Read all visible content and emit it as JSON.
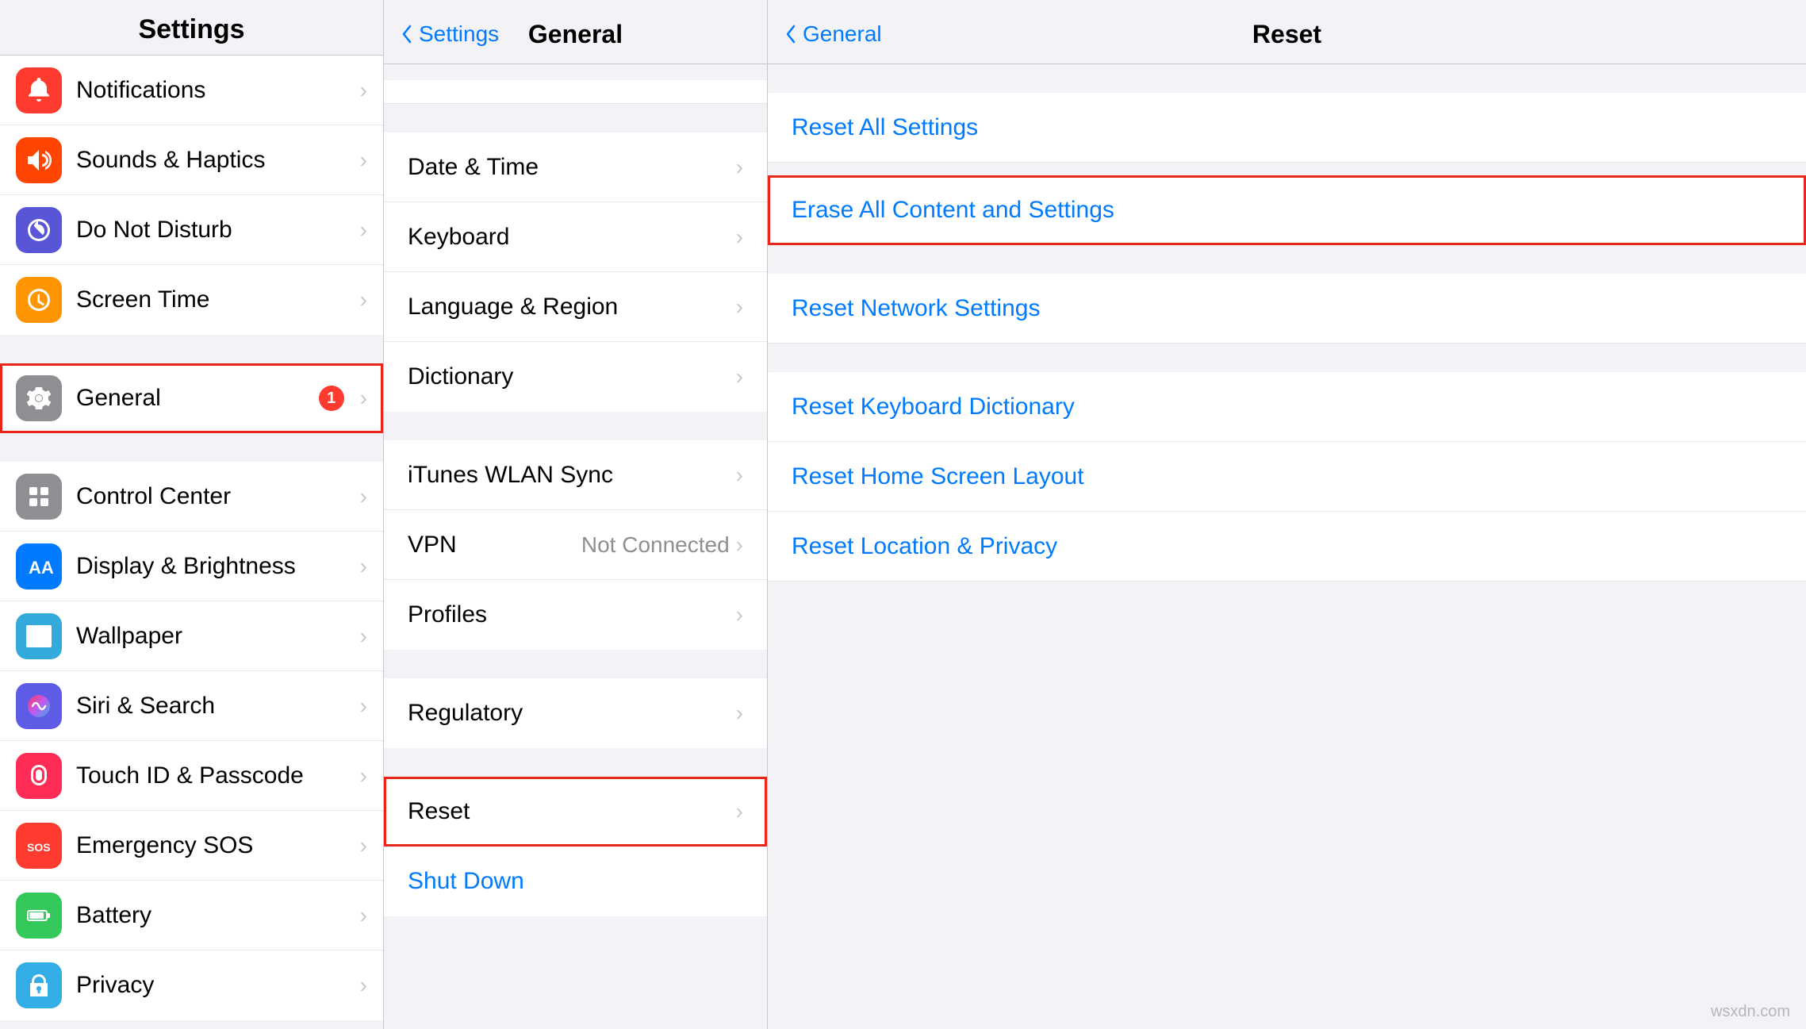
{
  "settings_column": {
    "title": "Settings",
    "items": [
      {
        "id": "notifications",
        "label": "Notifications",
        "icon_color": "icon-red",
        "icon_type": "bell",
        "badge": null
      },
      {
        "id": "sounds",
        "label": "Sounds & Haptics",
        "icon_color": "icon-orange-red",
        "icon_type": "sound",
        "badge": null
      },
      {
        "id": "dnd",
        "label": "Do Not Disturb",
        "icon_color": "icon-purple",
        "icon_type": "moon",
        "badge": null
      },
      {
        "id": "screentime",
        "label": "Screen Time",
        "icon_color": "icon-orange",
        "icon_type": "hourglass",
        "badge": null
      },
      {
        "id": "general",
        "label": "General",
        "icon_color": "icon-gray",
        "icon_type": "gear",
        "badge": "1",
        "selected": true
      },
      {
        "id": "controlcenter",
        "label": "Control Center",
        "icon_color": "icon-gray",
        "icon_type": "sliders",
        "badge": null
      },
      {
        "id": "display",
        "label": "Display & Brightness",
        "icon_color": "icon-blue",
        "icon_type": "aa",
        "badge": null
      },
      {
        "id": "wallpaper",
        "label": "Wallpaper",
        "icon_color": "icon-teal",
        "icon_type": "flower",
        "badge": null
      },
      {
        "id": "siri",
        "label": "Siri & Search",
        "icon_color": "icon-indigo",
        "icon_type": "siri",
        "badge": null
      },
      {
        "id": "touchid",
        "label": "Touch ID & Passcode",
        "icon_color": "icon-pink",
        "icon_type": "fingerprint",
        "badge": null
      },
      {
        "id": "emergencysos",
        "label": "Emergency SOS",
        "icon_color": "icon-sos",
        "icon_type": "sos",
        "badge": null
      },
      {
        "id": "battery",
        "label": "Battery",
        "icon_color": "icon-green",
        "icon_type": "battery",
        "badge": null
      },
      {
        "id": "privacy",
        "label": "Privacy",
        "icon_color": "icon-light-blue",
        "icon_type": "hand",
        "badge": null
      }
    ]
  },
  "general_column": {
    "back_label": "Settings",
    "title": "General",
    "items_top": [
      {
        "id": "datetime",
        "label": "Date & Time"
      },
      {
        "id": "keyboard",
        "label": "Keyboard"
      },
      {
        "id": "language",
        "label": "Language & Region"
      },
      {
        "id": "dictionary",
        "label": "Dictionary"
      }
    ],
    "items_mid": [
      {
        "id": "itunes",
        "label": "iTunes WLAN Sync"
      },
      {
        "id": "vpn",
        "label": "VPN",
        "value": "Not Connected"
      },
      {
        "id": "profiles",
        "label": "Profiles"
      }
    ],
    "items_bot": [
      {
        "id": "regulatory",
        "label": "Regulatory"
      }
    ],
    "items_last": [
      {
        "id": "reset",
        "label": "Reset",
        "selected": true
      },
      {
        "id": "shutdown",
        "label": "Shut Down",
        "blue": true
      }
    ]
  },
  "reset_column": {
    "back_label": "General",
    "title": "Reset",
    "items": [
      {
        "id": "reset_all",
        "label": "Reset All Settings",
        "selected": false
      },
      {
        "id": "erase_all",
        "label": "Erase All Content and Settings",
        "selected": true
      },
      {
        "id": "reset_network",
        "label": "Reset Network Settings",
        "selected": false
      },
      {
        "id": "reset_keyboard",
        "label": "Reset Keyboard Dictionary",
        "selected": false
      },
      {
        "id": "reset_homescreen",
        "label": "Reset Home Screen Layout",
        "selected": false
      },
      {
        "id": "reset_location",
        "label": "Reset Location & Privacy",
        "selected": false
      }
    ]
  },
  "watermark": "wsxdn.com"
}
